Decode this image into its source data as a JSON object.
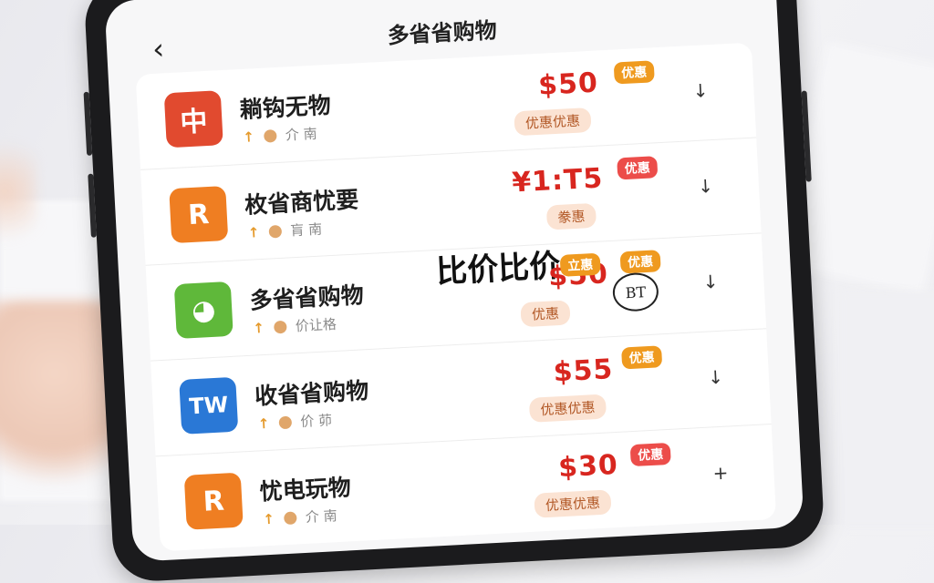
{
  "header": {
    "back_icon": "chevron-left-icon",
    "title": "多省省购物"
  },
  "colors": {
    "price_red": "#d8261f",
    "badge_orange": "#ef9a1f",
    "badge_red": "#ec4d4a"
  },
  "overlay_text": "比价比价",
  "items": [
    {
      "name": "耥钩无物",
      "logo_text": "中",
      "logo_color": "#e14a2f",
      "sub_up": "↑",
      "sub_text": "介 南",
      "price": "$50",
      "badge": "优惠",
      "pill": "优惠优惠",
      "arrow": "↓"
    },
    {
      "name": "枚省商忧要",
      "logo_text": "R",
      "logo_color": "#ef7e22",
      "sub_up": "↑",
      "sub_text": "肓 南",
      "price": "¥1:T5",
      "badge": "优惠",
      "pill": "豢惠",
      "arrow": "↓"
    },
    {
      "name": "多省省购物",
      "logo_text": "◕",
      "logo_color": "#5fb83a",
      "sub_up": "↑",
      "sub_text": "价让格",
      "price": "$50",
      "badges": [
        "立惠",
        "优惠"
      ],
      "pill": "优惠",
      "stamp": "BT",
      "arrow": "↓"
    },
    {
      "name": "收省省购物",
      "logo_text": "TW",
      "logo_color": "#2a78d6",
      "sub_up": "↑",
      "sub_text": "价 茆",
      "price": "$55",
      "badge": "优惠",
      "pill": "优惠优惠",
      "arrow": "↓"
    },
    {
      "name": "忧电玩物",
      "logo_text": "R",
      "logo_color": "#ef7e22",
      "sub_up": "↑",
      "sub_text": "介 南",
      "price": "$30",
      "badge": "优惠",
      "pill": "优惠优惠",
      "arrow": "+"
    }
  ]
}
